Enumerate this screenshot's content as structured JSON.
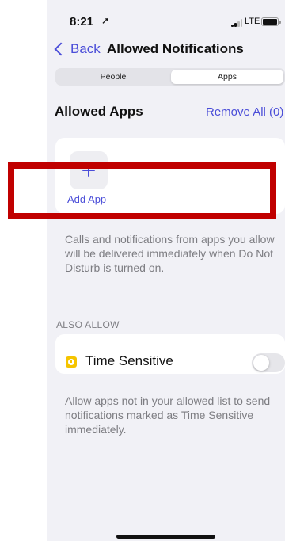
{
  "status_bar": {
    "time": "8:21",
    "time_arrow": "➚",
    "network": "LTE"
  },
  "nav": {
    "back_label": "Back",
    "title": "Allowed Notifications"
  },
  "segments": {
    "people": "People",
    "apps": "Apps",
    "selected": "Apps"
  },
  "allowed_apps": {
    "title": "Allowed Apps",
    "remove_all_label": "Remove All (0)",
    "add_app_label": "Add App",
    "description": "Calls and notifications from apps you allow will be delivered immediately when Do Not Disturb is turned on."
  },
  "also_allow": {
    "header": "ALSO ALLOW",
    "time_sensitive_label": "Time Sensitive",
    "time_sensitive_enabled": false,
    "description": "Allow apps not in your allowed list to send notifications marked as Time Sensitive immediately."
  },
  "colors": {
    "accent": "#4a4dd8",
    "background": "#f1f1f6",
    "highlight": "#c00000",
    "time_sensitive_icon": "#f5c400"
  },
  "icons": [
    "chevron-left-icon",
    "plus-icon",
    "time-sensitive-icon",
    "signal-icon",
    "battery-icon"
  ]
}
